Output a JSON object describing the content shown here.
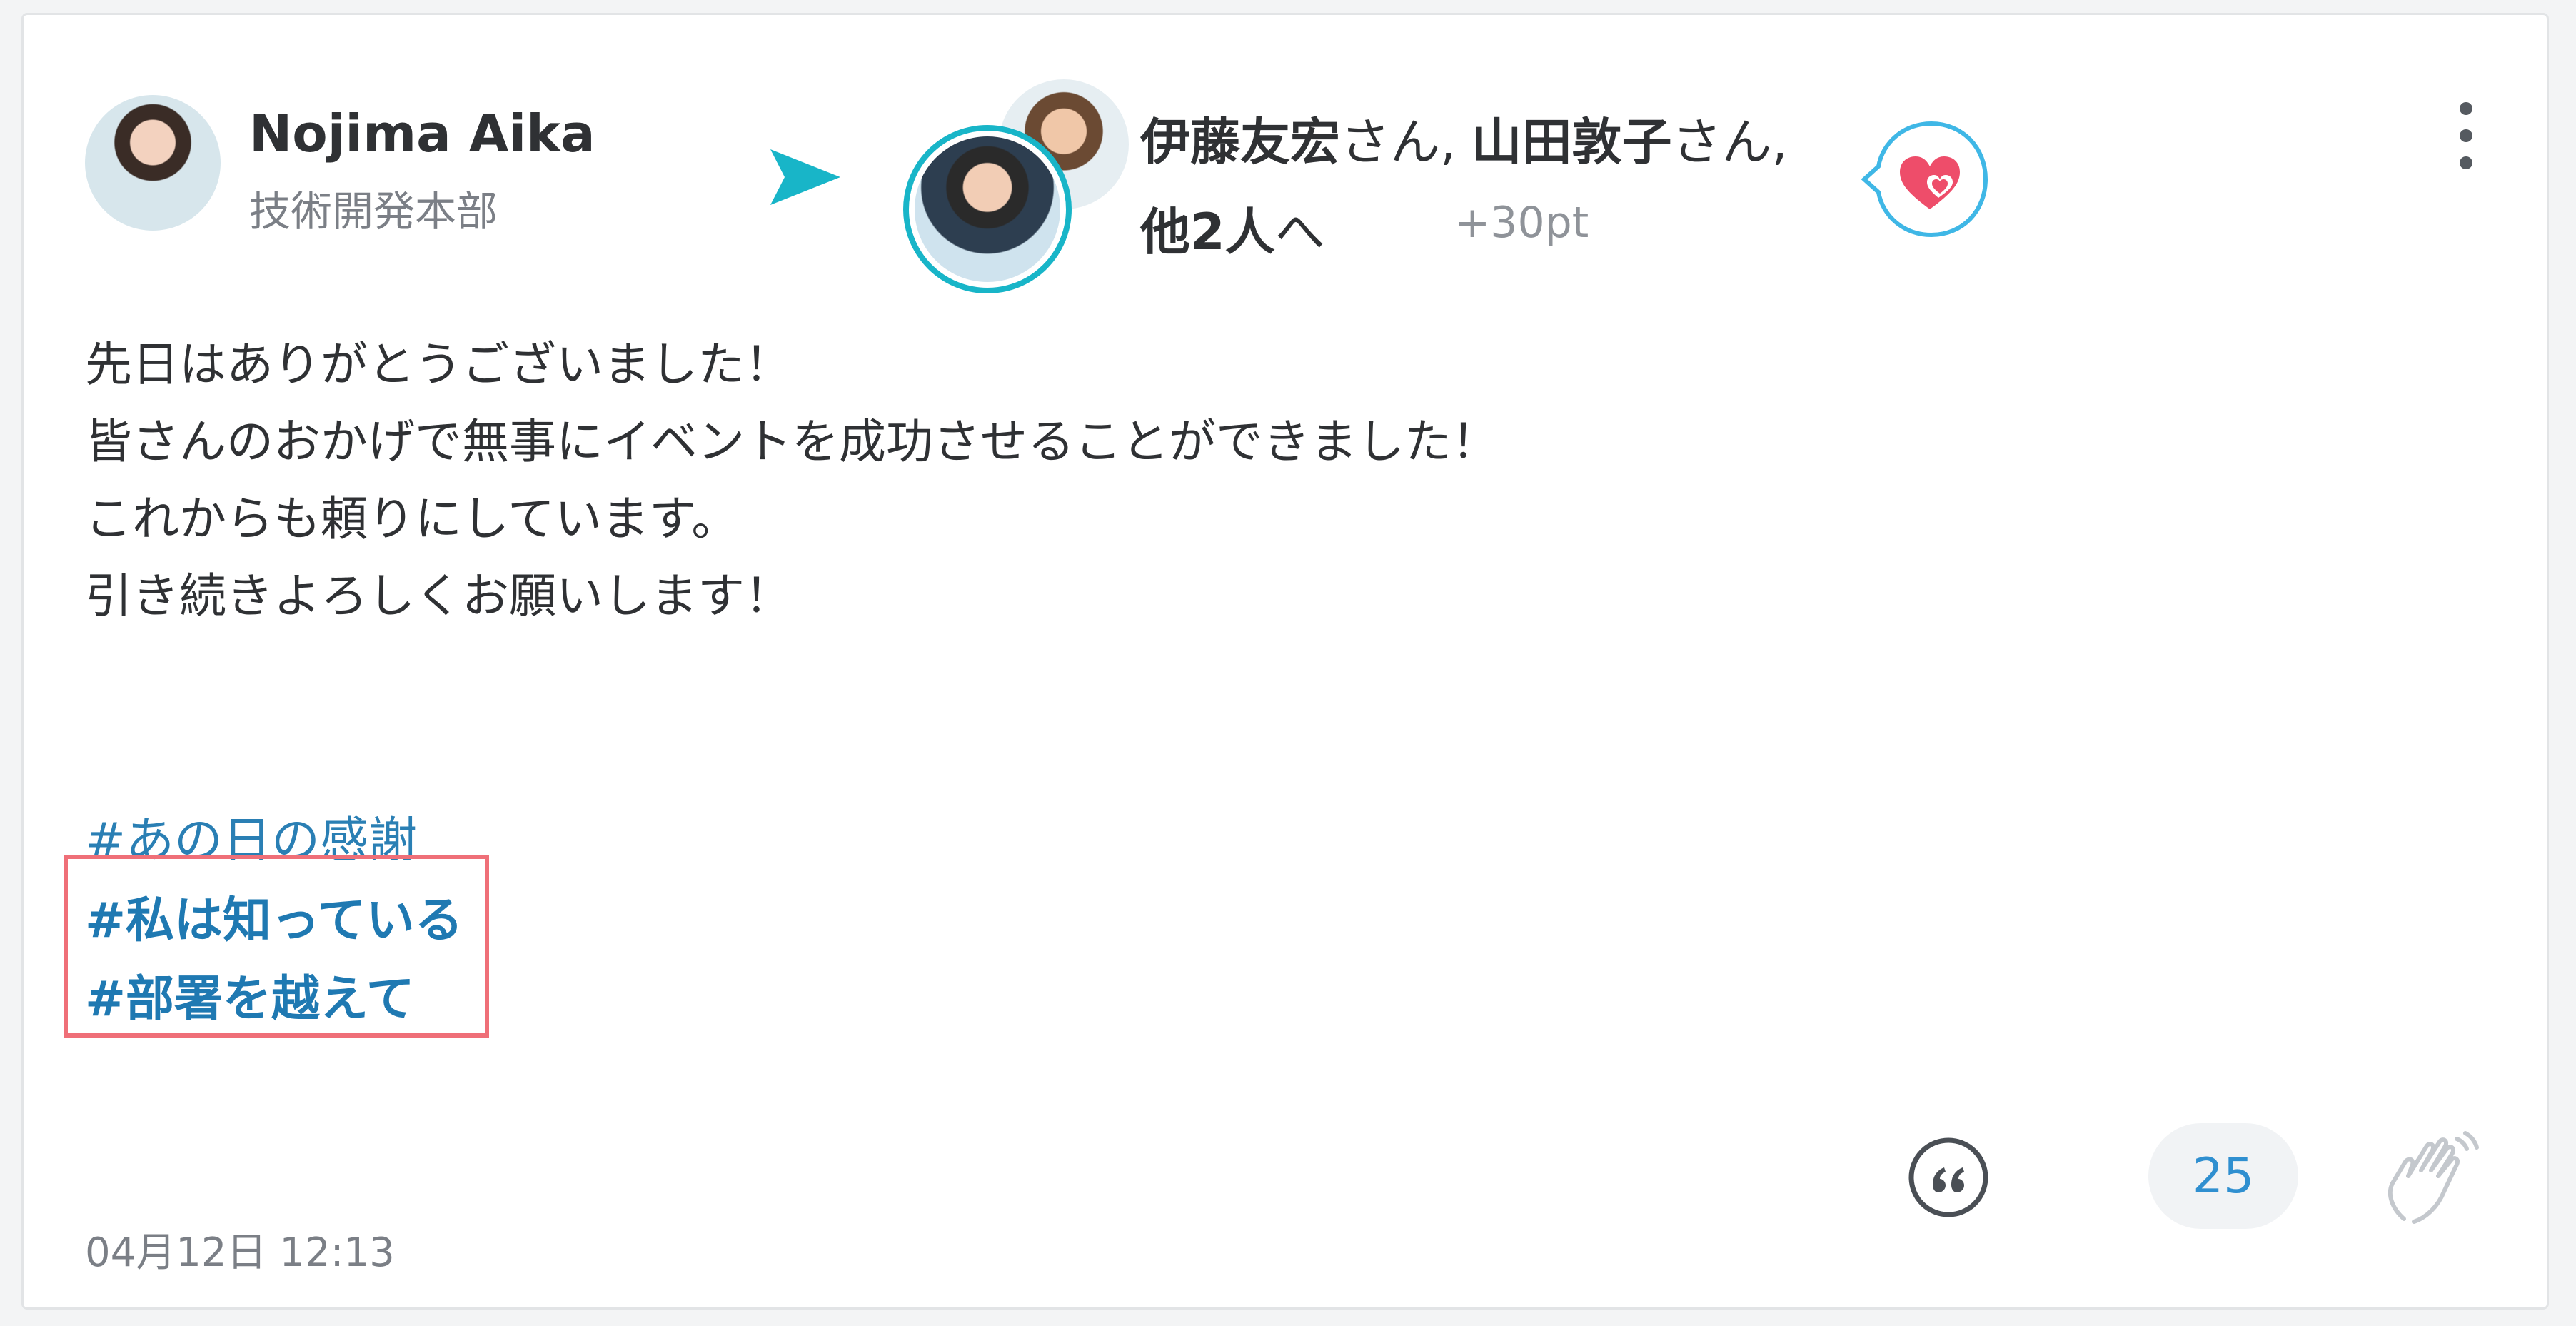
{
  "sender": {
    "name": "Nojima Aika",
    "department": "技術開発本部"
  },
  "recipients": {
    "name1": "伊藤友宏",
    "honorific1": "さん, ",
    "name2": "山田敦子",
    "honorific2": "さん,",
    "others": "他2人",
    "suffix": "へ",
    "points": "+30pt"
  },
  "message": {
    "lines": [
      "先日はありがとうございました！",
      "皆さんのおかげで無事にイベントを成功させることができました！",
      "これからも頼りにしています。",
      "引き続きよろしくお願いします！"
    ]
  },
  "hashtags": [
    "#あの日の感謝",
    "#私は知っている",
    "#部署を越えて"
  ],
  "footer": {
    "timestamp": "04月12日 12:13",
    "clap_count": "25"
  },
  "colors": {
    "accent": "#18b5c8",
    "tag": "#1f79b2",
    "highlight": "#ef6f78",
    "heart": "#ee4d6a"
  },
  "icons": {
    "send": "send-icon",
    "stamp": "heart-stamp-icon",
    "more": "more-vertical-icon",
    "quote": "quote-icon",
    "clap": "clap-icon"
  }
}
